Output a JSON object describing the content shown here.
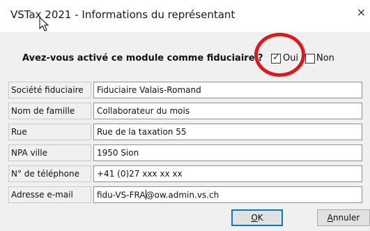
{
  "window": {
    "title": "VSTax 2021 - Informations du représentant",
    "close_glyph": "×"
  },
  "question": {
    "text": "Avez-vous activé ce module comme fiduciaire ?",
    "oui_label": "Oui",
    "non_label": "Non",
    "oui_checked": true,
    "non_checked": false,
    "check_glyph": "✓"
  },
  "fields": [
    {
      "label": "Société fiduciaire",
      "value": "Fiduciaire Valais-Romand"
    },
    {
      "label": "Nom de famille",
      "value": "Collaborateur du mois"
    },
    {
      "label": "Rue",
      "value": "Rue de la taxation 55"
    },
    {
      "label": "NPA ville",
      "value": "1950 Sion"
    },
    {
      "label": "N° de téléphone",
      "value": "+41 (0)27 xxx xx xx"
    },
    {
      "label": "Adresse e-mail",
      "value_before_caret": "fidu-VS-FRA",
      "value_after_caret": "@ow.admin.vs.ch"
    }
  ],
  "buttons": {
    "ok_underlined": "O",
    "ok_rest": "K",
    "cancel_underlined": "A",
    "cancel_rest": "nnuler"
  },
  "colors": {
    "highlight_circle": "#e0171b",
    "focus_border": "#0078d7"
  }
}
